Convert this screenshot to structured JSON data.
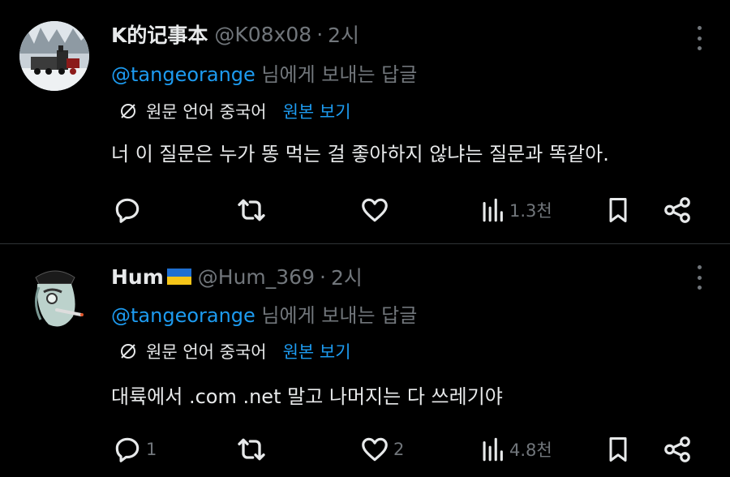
{
  "colors": {
    "background": "#000000",
    "text": "#e7e9ea",
    "muted": "#71767b",
    "link": "#1d9bf0",
    "divider": "#2f3336"
  },
  "tweets": [
    {
      "name": "K的记事本",
      "handle": "@K08x08",
      "dot": "·",
      "time": "2시",
      "reply_mention": "@tangeorange",
      "reply_suffix": " 님에게 보내는 답글",
      "original_language": "원문 언어 중국어",
      "show_original": "원본 보기",
      "text": "너 이 질문은 누가 똥 먹는 걸 좋아하지 않냐는 질문과 똑같아.",
      "actions": {
        "reply_count": "",
        "retweet_count": "",
        "like_count": "",
        "views": "1.3천"
      },
      "icons": [
        "avatar-train-photo",
        "more-icon",
        "translate-icon",
        "reply-icon",
        "retweet-icon",
        "like-icon",
        "views-icon",
        "bookmark-icon",
        "share-icon"
      ]
    },
    {
      "name": "Hum",
      "flag": "ukraine-flag",
      "handle": "@Hum_369",
      "dot": "·",
      "time": "2시",
      "reply_mention": "@tangeorange",
      "reply_suffix": " 님에게 보내는 답글",
      "original_language": "원문 언어 중국어",
      "show_original": "원본 보기",
      "text": "대륙에서 .com .net 말고 나머지는 다 쓰레기야",
      "actions": {
        "reply_count": "1",
        "retweet_count": "",
        "like_count": "2",
        "views": "4.8천"
      },
      "icons": [
        "avatar-cartoon-smoker",
        "more-icon",
        "translate-icon",
        "reply-icon",
        "retweet-icon",
        "like-icon",
        "views-icon",
        "bookmark-icon",
        "share-icon"
      ]
    }
  ]
}
